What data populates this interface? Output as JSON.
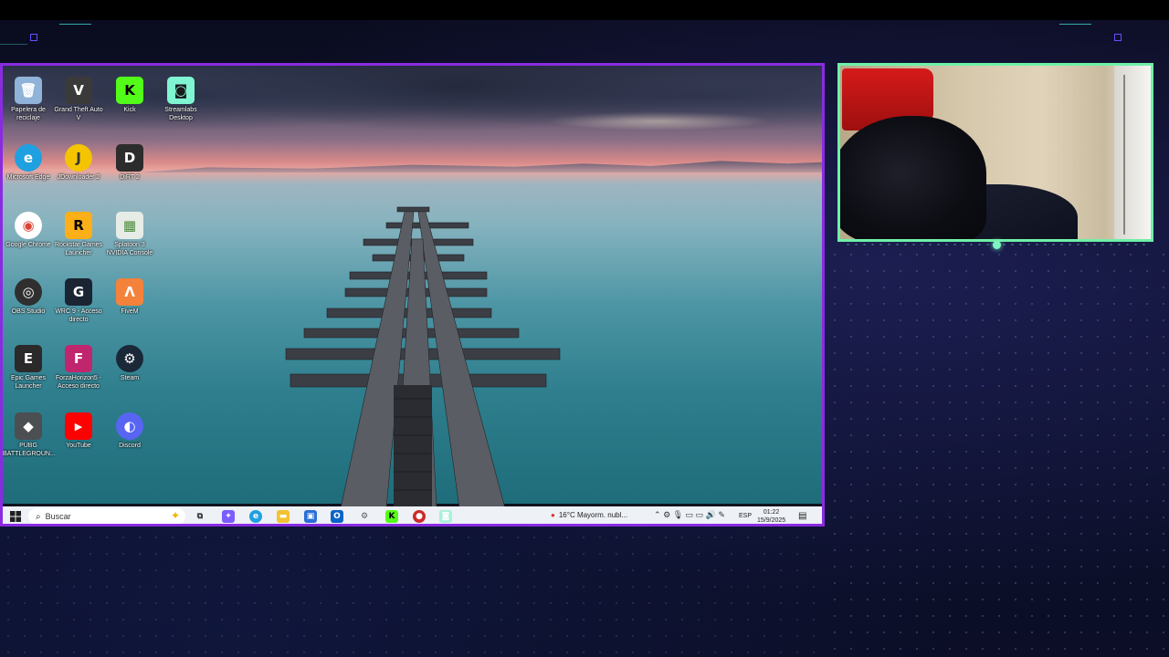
{
  "desktop": {
    "icons": [
      {
        "id": "recycle",
        "label": "Papelera de reciclaje",
        "glyph": "🗑",
        "bg": "#8fb3d9"
      },
      {
        "id": "gta",
        "label": "Grand Theft Auto V",
        "glyph": "V",
        "bg": "#3a3a3a"
      },
      {
        "id": "kick",
        "label": "Kick",
        "glyph": "K",
        "bg": "#53fc18"
      },
      {
        "id": "streamlabs",
        "label": "Streamlabs Desktop",
        "glyph": "◙",
        "bg": "#80f5d2"
      },
      {
        "id": "edge",
        "label": "Microsoft Edge",
        "glyph": "e",
        "bg": "#1fa0e0"
      },
      {
        "id": "jdownloader",
        "label": "JDownloader 2",
        "glyph": "J",
        "bg": "#f4c400"
      },
      {
        "id": "dirt",
        "label": "DiRT 2",
        "glyph": "D",
        "bg": "#2c2c2c"
      },
      {
        "id": "chrome",
        "label": "Google Chrome",
        "glyph": "◉",
        "bg": "#ffffff"
      },
      {
        "id": "rockstar",
        "label": "Rockstar Games Launcher",
        "glyph": "R",
        "bg": "#fcaf17"
      },
      {
        "id": "nvidia",
        "label": "Splatoon 3 NVIDIA Console",
        "glyph": "▦",
        "bg": "#e7ece6"
      },
      {
        "id": "obs",
        "label": "OBS Studio",
        "glyph": "◎",
        "bg": "#2f2f2f"
      },
      {
        "id": "wrc",
        "label": "WRC 9 - Acceso directo",
        "glyph": "G",
        "bg": "#1b2433"
      },
      {
        "id": "fivem",
        "label": "FiveM",
        "glyph": "Λ",
        "bg": "#f4823a"
      },
      {
        "id": "epic",
        "label": "Epic Games Launcher",
        "glyph": "E",
        "bg": "#2a2a2a"
      },
      {
        "id": "forza",
        "label": "ForzaHorizon5 - Acceso directo",
        "glyph": "F",
        "bg": "#c0266e"
      },
      {
        "id": "steam",
        "label": "Steam",
        "glyph": "⚙",
        "bg": "#1b2838"
      },
      {
        "id": "pubg",
        "label": "PUBG BATTLEGROUN...",
        "glyph": "◆",
        "bg": "#4b4f52"
      },
      {
        "id": "youtube",
        "label": "YouTube",
        "glyph": "▶",
        "bg": "#ff0000"
      },
      {
        "id": "discord",
        "label": "Discord",
        "glyph": "◐",
        "bg": "#5865f2"
      }
    ]
  },
  "taskbar": {
    "search_placeholder": "Buscar",
    "weather": "16°C  Mayorm. nubl...",
    "language": "ESP",
    "time": "01:22",
    "date": "15/9/2025",
    "apps": [
      {
        "id": "taskview",
        "glyph": "⧉",
        "bg": "#eef1f6",
        "fg": "#333"
      },
      {
        "id": "copilot",
        "glyph": "✦",
        "bg": "#7a5cff",
        "fg": "#fff"
      },
      {
        "id": "edge",
        "glyph": "e",
        "bg": "#1fa0e0",
        "fg": "#fff"
      },
      {
        "id": "explorer",
        "glyph": "▬",
        "bg": "#f2c230",
        "fg": "#fff"
      },
      {
        "id": "store",
        "glyph": "▣",
        "bg": "#2a6fd6",
        "fg": "#fff"
      },
      {
        "id": "outlook",
        "glyph": "O",
        "bg": "#0a64c8",
        "fg": "#fff"
      },
      {
        "id": "settings",
        "glyph": "⚙",
        "bg": "#eef1f6",
        "fg": "#555"
      },
      {
        "id": "kick",
        "glyph": "K",
        "bg": "#53fc18",
        "fg": "#000"
      },
      {
        "id": "recorder",
        "glyph": "●",
        "bg": "#cc2a2a",
        "fg": "#fff"
      },
      {
        "id": "streamlabs",
        "glyph": "◙",
        "bg": "#a9f0d8",
        "fg": "#fff"
      }
    ]
  },
  "colors": {
    "screen_border": "#8a2be2",
    "cam_border": "#6ff0a8"
  }
}
